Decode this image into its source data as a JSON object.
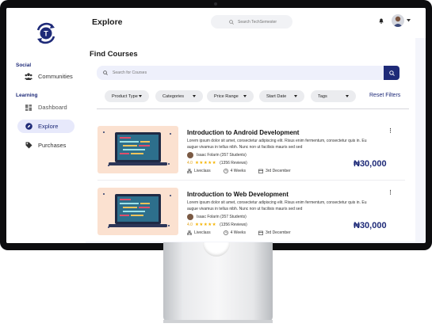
{
  "brand": {
    "logo_letter": "T",
    "accent": "#1e2a78"
  },
  "sidebar": {
    "sections": [
      {
        "title": "Social",
        "items": [
          {
            "label": "Communities",
            "icon": "users-icon"
          }
        ]
      },
      {
        "title": "Learning",
        "items": [
          {
            "label": "Dashboard",
            "icon": "dashboard-icon"
          },
          {
            "label": "Explore",
            "icon": "compass-icon",
            "active": true
          },
          {
            "label": "Purchases",
            "icon": "tag-icon"
          }
        ]
      }
    ]
  },
  "header": {
    "title": "Explore",
    "search_placeholder": "Search TechSemester"
  },
  "main": {
    "title": "Find Courses",
    "search_placeholder": "Search for Courses",
    "filters": [
      "Product Type",
      "Categories",
      "Price Range",
      "Start Date",
      "Tags"
    ],
    "reset_label": "Reset Filters"
  },
  "courses": [
    {
      "title": "Introduction to Android Development",
      "description": "Lorem ipsum dolor sit amet, consectetur adipiscing elit. Risus enim fermentum, consectetur quis in. Eu augue vivamus in tellus nibh. Nunc non ut facilisis mauris sed sed",
      "instructor": "Isaac Folarin (357 Students)",
      "rating": "4.0",
      "stars": "★★★★★",
      "reviews": "(1356 Reviews)",
      "mode": "Liveclass",
      "duration": "4 Weeks",
      "start": "3rd December",
      "price": "₦30,000"
    },
    {
      "title": "Introduction to Web Development",
      "description": "Lorem ipsum dolor sit amet, consectetur adipiscing elit. Risus enim fermentum, consectetur quis in. Eu augue vivamus in tellus nibh. Nunc non ut facilisis mauris sed sed",
      "instructor": "Isaac Folarin (357 Students)",
      "rating": "4.0",
      "stars": "★★★★★",
      "reviews": "(1356 Reviews)",
      "mode": "Liveclass",
      "duration": "4 Weeks",
      "start": "3rd December",
      "price": "₦30,000"
    }
  ]
}
